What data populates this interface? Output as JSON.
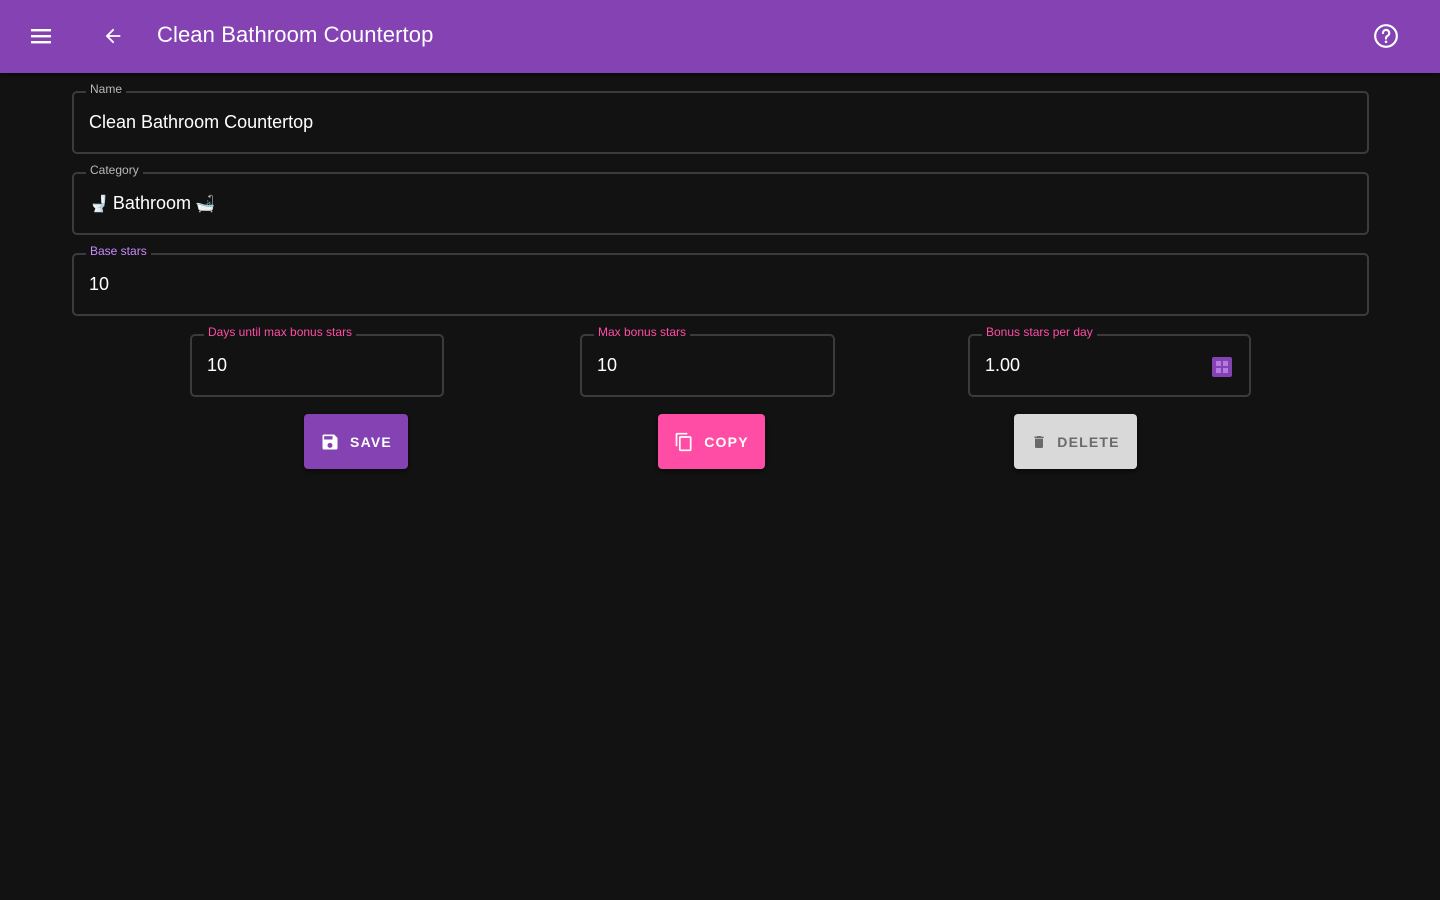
{
  "appbar": {
    "title": "Clean Bathroom Countertop",
    "color": "#8442b3",
    "menu_icon": "menu-icon",
    "back_icon": "arrow-back-icon",
    "help_icon": "help-circle-icon"
  },
  "fields": {
    "name": {
      "label": "Name",
      "value": "Clean Bathroom Countertop"
    },
    "category": {
      "label": "Category",
      "value": "Bathroom",
      "prefix_icon": "toilet-icon",
      "suffix_icon": "bathtub-icon"
    },
    "base_stars": {
      "label": "Base stars",
      "value": "10"
    },
    "days_until_max": {
      "label": "Days until max bonus stars",
      "value": "10"
    },
    "max_bonus": {
      "label": "Max bonus stars",
      "value": "10"
    },
    "bonus_per_day": {
      "label": "Bonus stars per day",
      "value": "1.00",
      "suffix_icon": "calculator-icon"
    }
  },
  "buttons": {
    "save": {
      "label": "SAVE",
      "icon": "save-icon",
      "color": "#8442b3"
    },
    "copy": {
      "label": "COPY",
      "icon": "copy-icon",
      "color": "#ff4da6"
    },
    "delete": {
      "label": "DELETE",
      "icon": "trash-icon",
      "color": "#d9d9d9"
    }
  }
}
